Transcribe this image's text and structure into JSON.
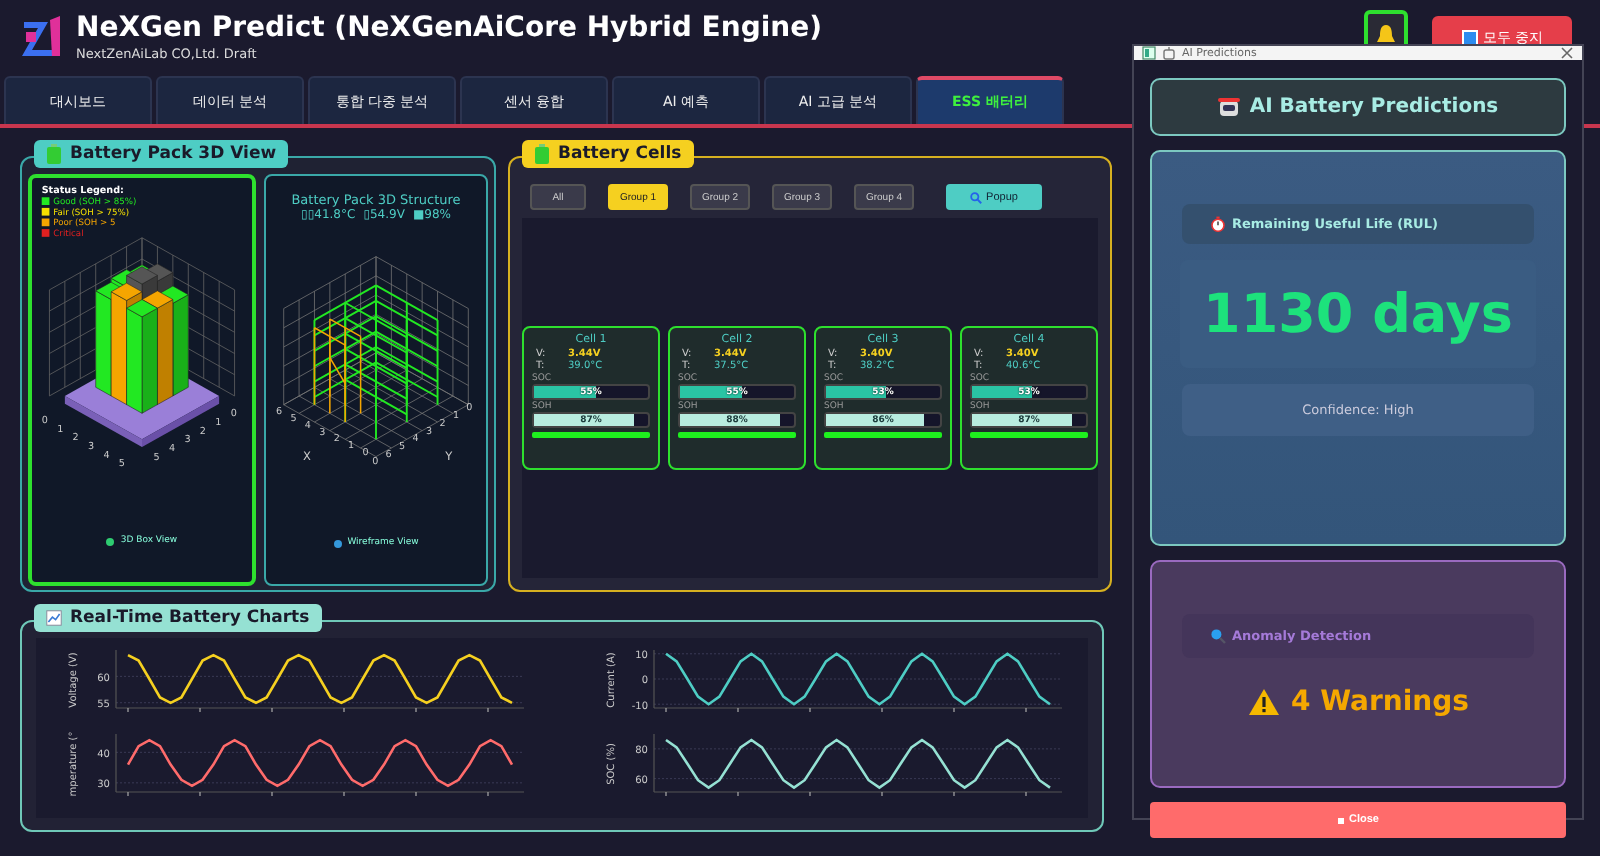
{
  "header": {
    "title": "NeXGen Predict (NeXGenAiCore Hybrid Engine)",
    "subtitle": "NextZenAiLab CO,Ltd. Draft",
    "stop_button": "모두 중지"
  },
  "tabs": [
    {
      "label": "대시보드",
      "selected": false
    },
    {
      "label": "데이터 분석",
      "selected": false
    },
    {
      "label": "통합 다중 분석",
      "selected": false
    },
    {
      "label": "센서 융합",
      "selected": false
    },
    {
      "label": "AI 예측",
      "selected": false
    },
    {
      "label": "AI 고급 분석",
      "selected": false
    },
    {
      "label": "ESS 배터리",
      "selected": true
    }
  ],
  "pack_view": {
    "title": "Battery Pack 3D View",
    "box_view": {
      "legend_title": "Status Legend:",
      "legend": [
        {
          "label": "Good (SOH > 85%)",
          "color": "#22e822"
        },
        {
          "label": "Fair (SOH > 75%)",
          "color": "#f5e000"
        },
        {
          "label": "Poor (SOH > 5",
          "color": "#f5a500"
        },
        {
          "label": "Critical",
          "color": "#e02020"
        }
      ],
      "x_ticks": [
        "0",
        "1",
        "2",
        "3",
        "4",
        "5"
      ],
      "y_ticks": [
        "5",
        "4",
        "3",
        "2",
        "1",
        "0"
      ],
      "caption": "3D Box View"
    },
    "wireframe_view": {
      "title": "Battery Pack 3D Structure",
      "readings": [
        "▯▯41.8°C",
        "▯54.9V",
        "■98%"
      ],
      "x_ticks": [
        "6",
        "5",
        "4",
        "3",
        "2",
        "1",
        "0"
      ],
      "y_ticks": [
        "0",
        "6",
        "5",
        "4",
        "3",
        "2",
        "1",
        "0"
      ],
      "x_label": "X",
      "y_label": "Y",
      "caption": "Wireframe View"
    }
  },
  "cells_panel": {
    "title": "Battery Cells",
    "groups": [
      {
        "label": "All",
        "selected": false
      },
      {
        "label": "Group 1",
        "selected": true
      },
      {
        "label": "Group 2",
        "selected": false
      },
      {
        "label": "Group 3",
        "selected": false
      },
      {
        "label": "Group 4",
        "selected": false
      }
    ],
    "popup_button": "Popup",
    "cells": [
      {
        "name": "Cell 1",
        "voltage_label": "V:",
        "voltage": "3.44V",
        "temperature_label": "T:",
        "temperature": "39.0°C",
        "soc_label": "SOC",
        "soc": {
          "level": 0.55,
          "reading": "55%"
        },
        "soh_label": "SOH",
        "soh": {
          "level": 0.87,
          "reading": "87%"
        }
      },
      {
        "name": "Cell 2",
        "voltage_label": "V:",
        "voltage": "3.44V",
        "temperature_label": "T:",
        "temperature": "37.5°C",
        "soc_label": "SOC",
        "soc": {
          "level": 0.55,
          "reading": "55%"
        },
        "soh_label": "SOH",
        "soh": {
          "level": 0.88,
          "reading": "88%"
        }
      },
      {
        "name": "Cell 3",
        "voltage_label": "V:",
        "voltage": "3.40V",
        "temperature_label": "T:",
        "temperature": "38.2°C",
        "soc_label": "SOC",
        "soc": {
          "level": 0.53,
          "reading": "53%"
        },
        "soh_label": "SOH",
        "soh": {
          "level": 0.86,
          "reading": "86%"
        }
      },
      {
        "name": "Cell 4",
        "voltage_label": "V:",
        "voltage": "3.40V",
        "temperature_label": "T:",
        "temperature": "40.6°C",
        "soc_label": "SOC",
        "soc": {
          "level": 0.53,
          "reading": "53%"
        },
        "soh_label": "SOH",
        "soh": {
          "level": 0.87,
          "reading": "87%"
        }
      }
    ]
  },
  "charts_panel": {
    "title": "Real-Time Battery Charts",
    "charts": [
      {
        "chart_data": {
          "type": "line",
          "ylabel": "Voltage (V)",
          "ylim": [
            54,
            65
          ],
          "yticks": [
            55,
            60
          ],
          "series": [
            {
              "color": "#f5d020",
              "values": [
                64,
                63,
                59.5,
                56,
                55,
                56,
                59.5,
                63,
                64,
                63,
                59.5,
                56,
                55,
                56,
                59.5,
                63,
                64,
                63,
                59.5,
                56,
                55,
                56,
                59.5,
                63,
                64,
                63,
                59.5,
                56,
                55,
                56,
                59.5,
                63,
                64,
                63,
                59.5,
                56,
                55
              ]
            }
          ]
        }
      },
      {
        "chart_data": {
          "type": "line",
          "ylabel": "Current (A)",
          "ylim": [
            -11.5,
            11.5
          ],
          "yticks": [
            -10,
            0,
            10
          ],
          "series": [
            {
              "color": "#4ecdc4",
              "values": [
                10,
                7,
                0,
                -7,
                -10,
                -7,
                0,
                7,
                10,
                7,
                0,
                -7,
                -10,
                -7,
                0,
                7,
                10,
                7,
                0,
                -7,
                -10,
                -7,
                0,
                7,
                10,
                7,
                0,
                -7,
                -10,
                -7,
                0,
                7,
                10,
                7,
                0,
                -7,
                -10
              ]
            }
          ]
        }
      },
      {
        "chart_data": {
          "type": "line",
          "ylabel": "mperature (°",
          "ylim": [
            27,
            46
          ],
          "yticks": [
            30,
            40
          ],
          "series": [
            {
              "color": "#ff6b6b",
              "values": [
                36,
                42,
                44,
                42,
                36,
                31,
                29,
                31,
                36,
                42,
                44,
                42,
                36,
                31,
                29,
                31,
                36,
                42,
                44,
                42,
                36,
                31,
                29,
                31,
                36,
                42,
                44,
                42,
                36,
                31,
                29,
                31,
                36,
                42,
                44,
                42,
                36
              ]
            }
          ]
        }
      },
      {
        "chart_data": {
          "type": "line",
          "ylabel": "SOC (%)",
          "ylim": [
            51,
            90
          ],
          "yticks": [
            60,
            80
          ],
          "series": [
            {
              "color": "#95e1d3",
              "values": [
                86,
                81,
                70,
                59,
                54,
                59,
                70,
                81,
                86,
                81,
                70,
                59,
                54,
                59,
                70,
                81,
                86,
                81,
                70,
                59,
                54,
                59,
                70,
                81,
                86,
                81,
                70,
                59,
                54,
                59,
                70,
                81,
                86,
                81,
                70,
                59,
                54
              ]
            }
          ]
        }
      }
    ]
  },
  "popup": {
    "window_title": "AI Predictions",
    "title": "AI Battery Predictions",
    "rul": {
      "label": "Remaining Useful Life (RUL)",
      "value": "1130 days",
      "confidence": "Confidence: High"
    },
    "anomaly": {
      "label": "Anomaly Detection",
      "value": "4 Warnings"
    },
    "close_button": "Close"
  }
}
